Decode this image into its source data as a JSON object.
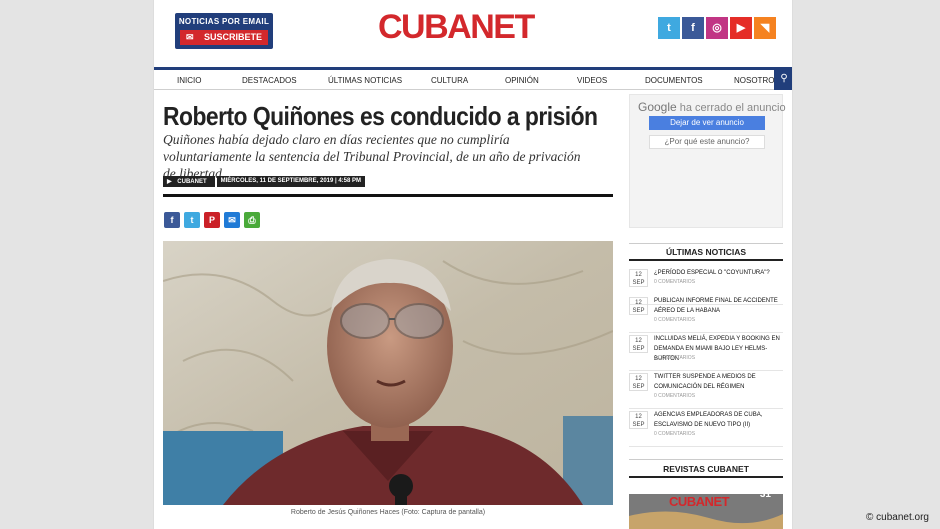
{
  "header": {
    "newsletter_label": "NOTICIAS POR EMAIL",
    "subscribe_label": "SUSCRIBETE",
    "logo_text": "CUBANET"
  },
  "nav": {
    "items": [
      "INICIO",
      "DESTACADOS",
      "ÚLTIMAS NOTICIAS",
      "CULTURA",
      "OPINIÓN",
      "VIDEOS",
      "DOCUMENTOS",
      "NOSOTROS"
    ]
  },
  "article": {
    "title": "Roberto Quiñones es conducido a prisión",
    "subtitle": "Quiñones había dejado claro en días recientes que no cumpliría voluntariamente la sentencia del Tribunal Provincial, de un año de privación de libertad",
    "author": "CUBANET",
    "date": "MIÉRCOLES, 11 DE SEPTIEMBRE, 2019 | 4:58 PM",
    "caption": "Roberto de Jesús Quiñones Haces (Foto: Captura de pantalla)"
  },
  "ad": {
    "google": "Google",
    "closed": "ha cerrado el anuncio",
    "stop": "Dejar de ver anuncio",
    "why": "¿Por qué este anuncio?"
  },
  "sidebar": {
    "latest_title": "ÚLTIMAS NOTICIAS",
    "news": [
      {
        "day": "12",
        "month": "SEP",
        "title": "¿PERÍODO ESPECIAL O \"COYUNTURA\"?",
        "comments": "0 COMENTARIOS"
      },
      {
        "day": "12",
        "month": "SEP",
        "title": "PUBLICAN INFORME FINAL DE ACCIDENTE AÉREO DE LA HABANA",
        "comments": "0 COMENTARIOS"
      },
      {
        "day": "12",
        "month": "SEP",
        "title": "INCLUIDAS MELIÁ, EXPEDIA Y BOOKING EN DEMANDA EN MIAMI BAJO LEY HELMS-BURTON",
        "comments": "0 COMENTARIOS"
      },
      {
        "day": "12",
        "month": "SEP",
        "title": "TWITTER SUSPENDE A MEDIOS DE COMUNICACIÓN DEL RÉGIMEN",
        "comments": "0 COMENTARIOS"
      },
      {
        "day": "12",
        "month": "SEP",
        "title": "AGENCIAS EMPLEADORAS DE CUBA, ESCLAVISMO DE NUEVO TIPO (II)",
        "comments": "0 COMENTARIOS"
      }
    ],
    "magazines_title": "REVISTAS CUBANET",
    "magazine_logo": "CUBANET",
    "magazine_issue": "31"
  },
  "watermark": "© cubanet.org",
  "colors": {
    "brand_red": "#d3282c",
    "brand_blue": "#213e7b"
  }
}
